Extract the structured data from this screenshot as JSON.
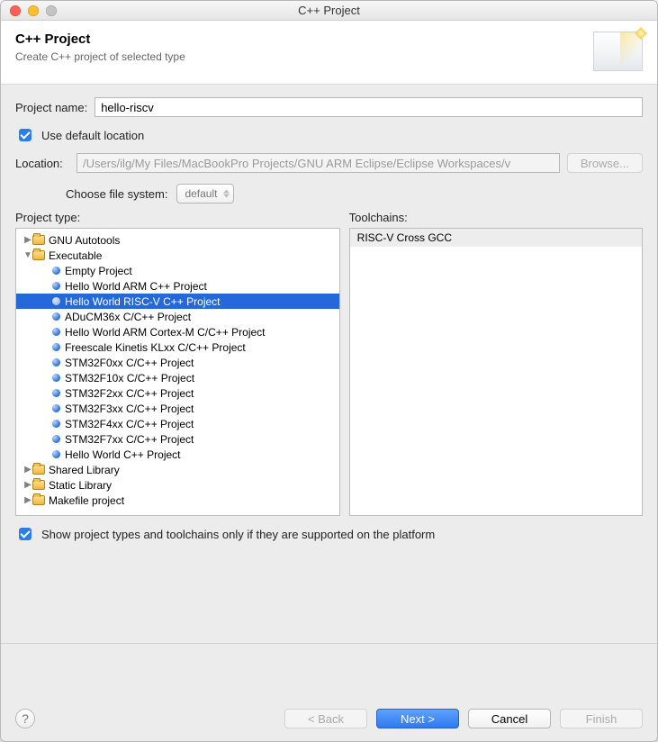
{
  "window": {
    "title": "C++ Project"
  },
  "header": {
    "title": "C++ Project",
    "subtitle": "Create C++ project of selected type"
  },
  "form": {
    "project_name_label": "Project name:",
    "project_name_value": "hello-riscv",
    "use_default_location_label": "Use default location",
    "use_default_location": true,
    "location_label": "Location:",
    "location_value": "/Users/ilg/My Files/MacBookPro Projects/GNU ARM Eclipse/Eclipse Workspaces/v",
    "browse_label": "Browse...",
    "choose_fs_label": "Choose file system:",
    "choose_fs_value": "default"
  },
  "columns": {
    "project_type_label": "Project type:",
    "toolchains_label": "Toolchains:"
  },
  "tree": [
    {
      "level": 0,
      "type": "folder",
      "expanded": false,
      "label": "GNU Autotools"
    },
    {
      "level": 0,
      "type": "folder",
      "expanded": true,
      "label": "Executable"
    },
    {
      "level": 1,
      "type": "leaf",
      "label": "Empty Project"
    },
    {
      "level": 1,
      "type": "leaf",
      "label": "Hello World ARM C++ Project"
    },
    {
      "level": 1,
      "type": "leaf",
      "label": "Hello World RISC-V C++ Project",
      "selected": true
    },
    {
      "level": 1,
      "type": "leaf",
      "label": "ADuCM36x C/C++ Project"
    },
    {
      "level": 1,
      "type": "leaf",
      "label": "Hello World ARM Cortex-M C/C++ Project"
    },
    {
      "level": 1,
      "type": "leaf",
      "label": "Freescale Kinetis KLxx C/C++ Project"
    },
    {
      "level": 1,
      "type": "leaf",
      "label": "STM32F0xx C/C++ Project"
    },
    {
      "level": 1,
      "type": "leaf",
      "label": "STM32F10x C/C++ Project"
    },
    {
      "level": 1,
      "type": "leaf",
      "label": "STM32F2xx C/C++ Project"
    },
    {
      "level": 1,
      "type": "leaf",
      "label": "STM32F3xx C/C++ Project"
    },
    {
      "level": 1,
      "type": "leaf",
      "label": "STM32F4xx C/C++ Project"
    },
    {
      "level": 1,
      "type": "leaf",
      "label": "STM32F7xx C/C++ Project"
    },
    {
      "level": 1,
      "type": "leaf",
      "label": "Hello World C++ Project"
    },
    {
      "level": 0,
      "type": "folder",
      "expanded": false,
      "label": "Shared Library"
    },
    {
      "level": 0,
      "type": "folder",
      "expanded": false,
      "label": "Static Library"
    },
    {
      "level": 0,
      "type": "folder",
      "expanded": false,
      "label": "Makefile project"
    }
  ],
  "toolchains": [
    "RISC-V Cross GCC"
  ],
  "supported": {
    "label": "Show project types and toolchains only if they are supported on the platform",
    "checked": true
  },
  "buttons": {
    "back": "< Back",
    "next": "Next >",
    "cancel": "Cancel",
    "finish": "Finish"
  }
}
